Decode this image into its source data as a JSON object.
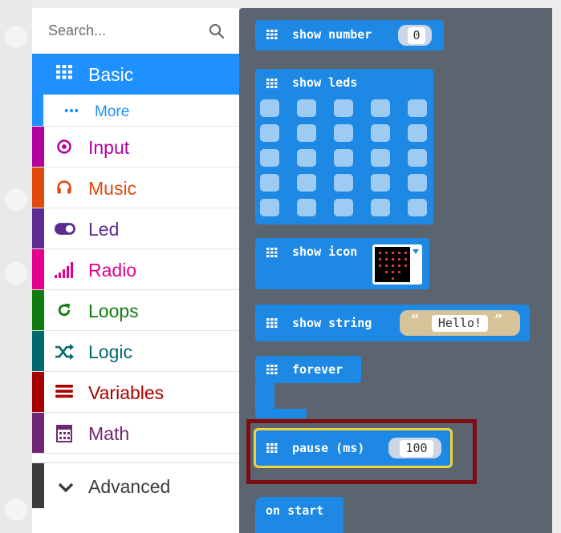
{
  "search": {
    "placeholder": "Search...",
    "icon": "search-icon"
  },
  "toolbox": {
    "categories": [
      {
        "label": "Basic",
        "color": "#1e90ff",
        "icon": "grid-icon"
      },
      {
        "label": "More",
        "color": "#1e90ff",
        "icon": "ellipsis-icon"
      },
      {
        "label": "Input",
        "color": "#b4009e",
        "icon": "target-icon"
      },
      {
        "label": "Music",
        "color": "#e04a0b",
        "icon": "headphones-icon"
      },
      {
        "label": "Led",
        "color": "#5c2d91",
        "icon": "toggle-icon"
      },
      {
        "label": "Radio",
        "color": "#e3008c",
        "icon": "signal-bars-icon"
      },
      {
        "label": "Loops",
        "color": "#107c10",
        "icon": "refresh-icon"
      },
      {
        "label": "Logic",
        "color": "#006970",
        "icon": "shuffle-icon"
      },
      {
        "label": "Variables",
        "color": "#a80000",
        "icon": "list-icon"
      },
      {
        "label": "Math",
        "color": "#712672",
        "icon": "calculator-icon"
      }
    ],
    "advanced": {
      "label": "Advanced",
      "color": "#3c3c3c",
      "icon": "chevron-down-icon"
    }
  },
  "blocks": {
    "show_number": {
      "text": "show number",
      "value": "0"
    },
    "show_leds": {
      "text": "show leds"
    },
    "show_icon": {
      "text": "show icon"
    },
    "show_string": {
      "text": "show string",
      "open_quote": "“",
      "value": "Hello!",
      "close_quote": "”"
    },
    "forever": {
      "text": "forever"
    },
    "pause": {
      "text": "pause (ms)",
      "value": "100"
    },
    "on_start": {
      "text": "on start"
    }
  },
  "colors": {
    "flyout_bg": "#5b6570",
    "block_basic": "#1e88e5",
    "highlight": "#7a0c12",
    "selected_outline": "#f2d43a"
  }
}
